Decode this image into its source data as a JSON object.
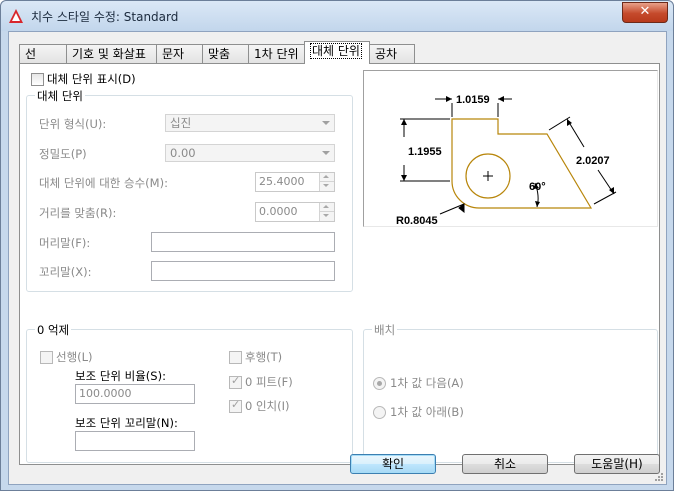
{
  "window": {
    "title": "치수 스타일 수정: Standard",
    "close_label": "✕"
  },
  "tabs": [
    {
      "label": "선"
    },
    {
      "label": "기호 및 화살표"
    },
    {
      "label": "문자"
    },
    {
      "label": "맞춤"
    },
    {
      "label": "1차 단위"
    },
    {
      "label": "대체 단위"
    },
    {
      "label": "공차"
    }
  ],
  "active_tab": "대체 단위",
  "display_alt_units": {
    "label": "대체 단위 표시(D)",
    "checked": false
  },
  "alt_units_group": {
    "title": "대체 단위",
    "unit_format": {
      "label": "단위 형식(U):",
      "value": "십진"
    },
    "precision": {
      "label": "정밀도(P)",
      "value": "0.00"
    },
    "multiplier": {
      "label": "대체 단위에 대한 승수(M):",
      "value": "25.4000"
    },
    "round_distances": {
      "label": "거리를 맞춤(R):",
      "value": "0.0000"
    },
    "prefix": {
      "label": "머리말(F):",
      "value": ""
    },
    "suffix": {
      "label": "꼬리말(X):",
      "value": ""
    }
  },
  "zero_suppression": {
    "title": "0 억제",
    "leading": {
      "label": "선행(L)",
      "checked": false
    },
    "sub_unit_factor": {
      "label": "보조 단위 비율(S):",
      "value": "100.0000"
    },
    "sub_unit_suffix": {
      "label": "보조 단위 꼬리말(N):",
      "value": ""
    },
    "trailing": {
      "label": "후행(T)",
      "checked": false
    },
    "zero_feet": {
      "label": "0 피트(F)",
      "checked": true
    },
    "zero_inches": {
      "label": "0 인치(I)",
      "checked": true
    }
  },
  "placement": {
    "title": "배치",
    "after_primary": {
      "label": "1차 값 다음(A)",
      "selected": true
    },
    "below_primary": {
      "label": "1차 값 아래(B)",
      "selected": false
    }
  },
  "preview": {
    "dims": [
      "1.0159",
      "1.1955",
      "2.0207",
      "60°",
      "R0.8045"
    ],
    "line_color": "#b8860b"
  },
  "buttons": {
    "ok": "확인",
    "cancel": "취소",
    "help": "도움말(H)"
  },
  "colors": {
    "title_bg": "#c2d6ec",
    "close_red": "#c54a2c",
    "default_btn": "#3c7fb1"
  }
}
